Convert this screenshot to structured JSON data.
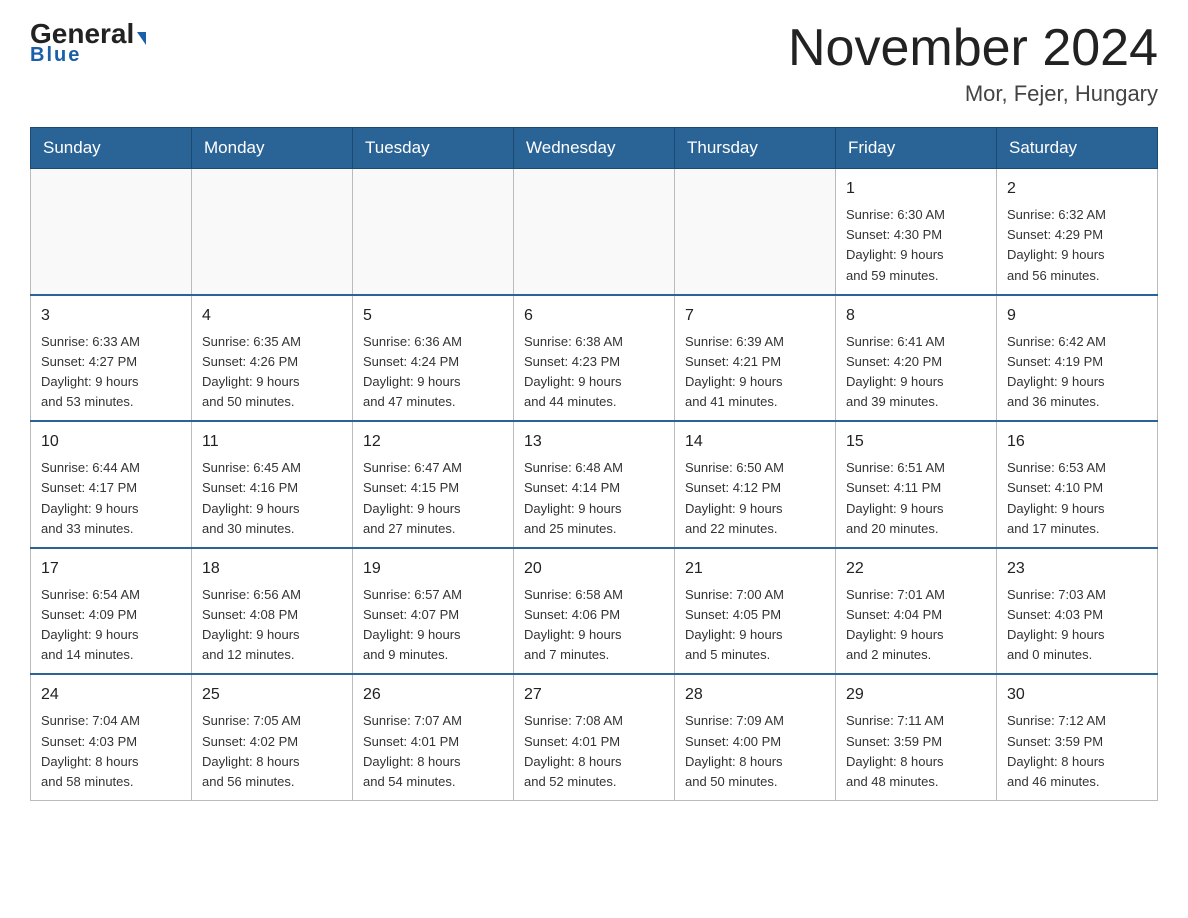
{
  "header": {
    "logo_general": "General",
    "logo_blue": "Blue",
    "month_title": "November 2024",
    "location": "Mor, Fejer, Hungary"
  },
  "weekdays": [
    "Sunday",
    "Monday",
    "Tuesday",
    "Wednesday",
    "Thursday",
    "Friday",
    "Saturday"
  ],
  "weeks": [
    [
      {
        "day": "",
        "info": ""
      },
      {
        "day": "",
        "info": ""
      },
      {
        "day": "",
        "info": ""
      },
      {
        "day": "",
        "info": ""
      },
      {
        "day": "",
        "info": ""
      },
      {
        "day": "1",
        "info": "Sunrise: 6:30 AM\nSunset: 4:30 PM\nDaylight: 9 hours\nand 59 minutes."
      },
      {
        "day": "2",
        "info": "Sunrise: 6:32 AM\nSunset: 4:29 PM\nDaylight: 9 hours\nand 56 minutes."
      }
    ],
    [
      {
        "day": "3",
        "info": "Sunrise: 6:33 AM\nSunset: 4:27 PM\nDaylight: 9 hours\nand 53 minutes."
      },
      {
        "day": "4",
        "info": "Sunrise: 6:35 AM\nSunset: 4:26 PM\nDaylight: 9 hours\nand 50 minutes."
      },
      {
        "day": "5",
        "info": "Sunrise: 6:36 AM\nSunset: 4:24 PM\nDaylight: 9 hours\nand 47 minutes."
      },
      {
        "day": "6",
        "info": "Sunrise: 6:38 AM\nSunset: 4:23 PM\nDaylight: 9 hours\nand 44 minutes."
      },
      {
        "day": "7",
        "info": "Sunrise: 6:39 AM\nSunset: 4:21 PM\nDaylight: 9 hours\nand 41 minutes."
      },
      {
        "day": "8",
        "info": "Sunrise: 6:41 AM\nSunset: 4:20 PM\nDaylight: 9 hours\nand 39 minutes."
      },
      {
        "day": "9",
        "info": "Sunrise: 6:42 AM\nSunset: 4:19 PM\nDaylight: 9 hours\nand 36 minutes."
      }
    ],
    [
      {
        "day": "10",
        "info": "Sunrise: 6:44 AM\nSunset: 4:17 PM\nDaylight: 9 hours\nand 33 minutes."
      },
      {
        "day": "11",
        "info": "Sunrise: 6:45 AM\nSunset: 4:16 PM\nDaylight: 9 hours\nand 30 minutes."
      },
      {
        "day": "12",
        "info": "Sunrise: 6:47 AM\nSunset: 4:15 PM\nDaylight: 9 hours\nand 27 minutes."
      },
      {
        "day": "13",
        "info": "Sunrise: 6:48 AM\nSunset: 4:14 PM\nDaylight: 9 hours\nand 25 minutes."
      },
      {
        "day": "14",
        "info": "Sunrise: 6:50 AM\nSunset: 4:12 PM\nDaylight: 9 hours\nand 22 minutes."
      },
      {
        "day": "15",
        "info": "Sunrise: 6:51 AM\nSunset: 4:11 PM\nDaylight: 9 hours\nand 20 minutes."
      },
      {
        "day": "16",
        "info": "Sunrise: 6:53 AM\nSunset: 4:10 PM\nDaylight: 9 hours\nand 17 minutes."
      }
    ],
    [
      {
        "day": "17",
        "info": "Sunrise: 6:54 AM\nSunset: 4:09 PM\nDaylight: 9 hours\nand 14 minutes."
      },
      {
        "day": "18",
        "info": "Sunrise: 6:56 AM\nSunset: 4:08 PM\nDaylight: 9 hours\nand 12 minutes."
      },
      {
        "day": "19",
        "info": "Sunrise: 6:57 AM\nSunset: 4:07 PM\nDaylight: 9 hours\nand 9 minutes."
      },
      {
        "day": "20",
        "info": "Sunrise: 6:58 AM\nSunset: 4:06 PM\nDaylight: 9 hours\nand 7 minutes."
      },
      {
        "day": "21",
        "info": "Sunrise: 7:00 AM\nSunset: 4:05 PM\nDaylight: 9 hours\nand 5 minutes."
      },
      {
        "day": "22",
        "info": "Sunrise: 7:01 AM\nSunset: 4:04 PM\nDaylight: 9 hours\nand 2 minutes."
      },
      {
        "day": "23",
        "info": "Sunrise: 7:03 AM\nSunset: 4:03 PM\nDaylight: 9 hours\nand 0 minutes."
      }
    ],
    [
      {
        "day": "24",
        "info": "Sunrise: 7:04 AM\nSunset: 4:03 PM\nDaylight: 8 hours\nand 58 minutes."
      },
      {
        "day": "25",
        "info": "Sunrise: 7:05 AM\nSunset: 4:02 PM\nDaylight: 8 hours\nand 56 minutes."
      },
      {
        "day": "26",
        "info": "Sunrise: 7:07 AM\nSunset: 4:01 PM\nDaylight: 8 hours\nand 54 minutes."
      },
      {
        "day": "27",
        "info": "Sunrise: 7:08 AM\nSunset: 4:01 PM\nDaylight: 8 hours\nand 52 minutes."
      },
      {
        "day": "28",
        "info": "Sunrise: 7:09 AM\nSunset: 4:00 PM\nDaylight: 8 hours\nand 50 minutes."
      },
      {
        "day": "29",
        "info": "Sunrise: 7:11 AM\nSunset: 3:59 PM\nDaylight: 8 hours\nand 48 minutes."
      },
      {
        "day": "30",
        "info": "Sunrise: 7:12 AM\nSunset: 3:59 PM\nDaylight: 8 hours\nand 46 minutes."
      }
    ]
  ]
}
